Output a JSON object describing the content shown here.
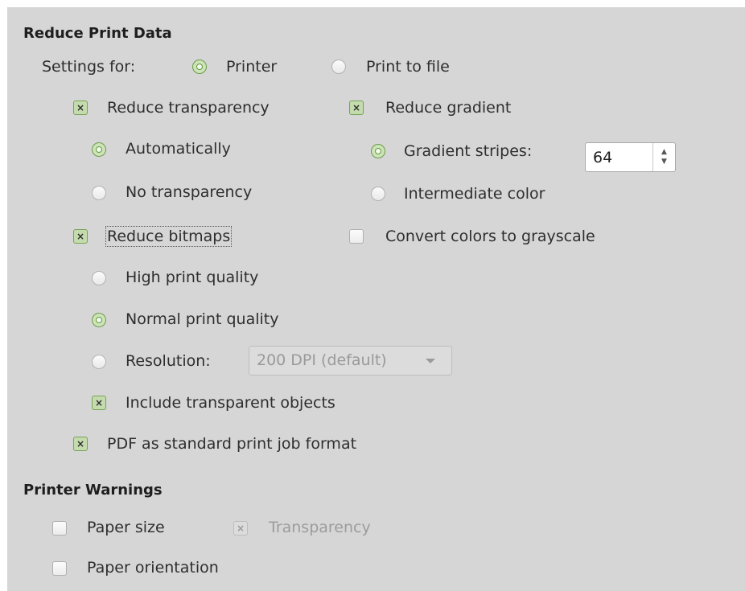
{
  "reduce_print_data": {
    "heading": "Reduce Print Data",
    "settings_for_label": "Settings for:",
    "printer_label": "Printer",
    "print_to_file_label": "Print to file",
    "reduce_transparency": {
      "label": "Reduce transparency",
      "checked": true,
      "automatically_label": "Automatically",
      "no_transparency_label": "No transparency",
      "selected": "Automatically"
    },
    "reduce_gradient": {
      "label": "Reduce gradient",
      "checked": true,
      "gradient_stripes_label": "Gradient stripes:",
      "gradient_stripes_value": "64",
      "intermediate_color_label": "Intermediate color",
      "selected": "Gradient stripes:"
    },
    "reduce_bitmaps": {
      "label": "Reduce bitmaps",
      "checked": true,
      "high_quality_label": "High print quality",
      "normal_quality_label": "Normal print quality",
      "resolution_label": "Resolution:",
      "resolution_value": "200 DPI (default)",
      "selected": "Normal print quality",
      "include_transparent_label": "Include transparent objects",
      "include_transparent_checked": true
    },
    "convert_grayscale_label": "Convert colors to grayscale",
    "convert_grayscale_checked": false,
    "pdf_standard_label": "PDF as standard print job format",
    "pdf_standard_checked": true
  },
  "printer_warnings": {
    "heading": "Printer Warnings",
    "paper_size_label": "Paper size",
    "paper_size_checked": false,
    "transparency_label": "Transparency",
    "transparency_checked": true,
    "transparency_enabled": false,
    "paper_orientation_label": "Paper orientation",
    "paper_orientation_checked": false
  },
  "icons": {
    "checkbox_mark": "×"
  },
  "colors": {
    "panel_bg": "#d6d6d6",
    "accent_green": "#6c9b49",
    "disabled_text": "#9c9c9c"
  }
}
